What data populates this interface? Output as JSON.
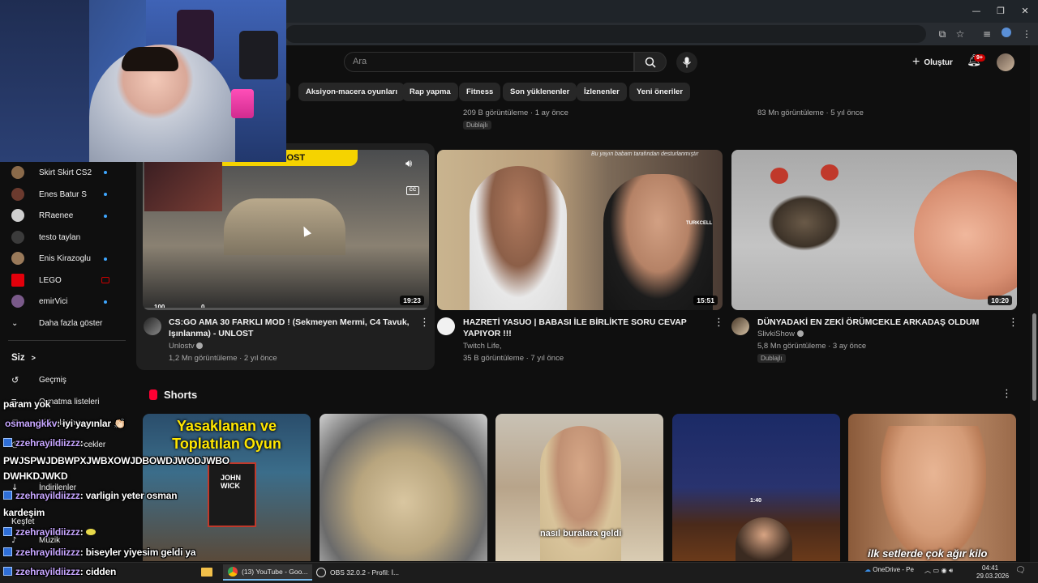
{
  "header": {
    "search_placeholder": "Ara",
    "create_label": "Oluştur",
    "notification_badge": "9+"
  },
  "chips": [
    "Aksiyon-macera oyunları",
    "Rap yapma",
    "Fitness",
    "Son yüklenenler",
    "İzlenenler",
    "Yeni öneriler"
  ],
  "prev_row": {
    "left_meta": "209 B görüntüleme · 1 ay önce",
    "left_badge": "Dublajlı",
    "right_meta": "83 Mn görüntüleme · 5 yıl önce"
  },
  "sidebar": {
    "subscriptions": [
      {
        "label": "Skirt Skirt CS2",
        "color": "#8a6a4a"
      },
      {
        "label": "Enes Batur S",
        "color": "#6b3a2e"
      },
      {
        "label": "RRaenee",
        "color": "#cfcfcf"
      },
      {
        "label": "testo taylan",
        "color": "#3b3b3b"
      },
      {
        "label": "Enis Kirazoglu",
        "color": "#9a7a5a"
      },
      {
        "label": "LEGO",
        "color": "#e3000b"
      },
      {
        "label": "emirVici",
        "color": "#7a5a8a"
      }
    ],
    "show_more": "Daha fazla göster",
    "you_label": "Siz",
    "you_chevron": ">",
    "history": "Geçmiş",
    "playlists": "Oynatma listeleri",
    "your_videos": "Videolarınız",
    "watch_later": "Sonra izlenecekler",
    "downloads": "İndirilenler",
    "explore": "Keşfet",
    "music": "Müzik"
  },
  "videos": [
    {
      "title": "CS:GO AMA 30 FARKLI MOD ! (Sekmeyen Mermi, C4 Tavuk, Işınlanma) - UNLOST",
      "channel": "Unlostv",
      "meta": "1,2 Mn görüntüleme · 2 yıl önce",
      "duration": "19:23",
      "banner": "UNLOST",
      "hud_left": "100",
      "hud_right": "0"
    },
    {
      "title": "HAZRETİ YASUO | BABASI İLE BİRLİKTE SORU CEVAP YAPIYOR !!!",
      "channel": "Twitch Life,",
      "meta": "35 B görüntüleme · 7 yıl önce",
      "duration": "15:51",
      "overlay": "Bu yayın babam tarafından desturlanmıştır",
      "logo": "TURKCELL"
    },
    {
      "title": "DÜNYADAKİ EN ZEKİ ÖRÜMCEKLE ARKADAŞ OLDUM",
      "channel": "SlivkiShow",
      "meta": "5,8 Mn görüntüleme · 3 ay önce",
      "duration": "10:20",
      "badge": "Dublajlı"
    }
  ],
  "shorts": {
    "title": "Shorts",
    "items": [
      {
        "caption": "Yasaklanan ve Toplatılan Oyun",
        "sub": "JOHN WICK"
      },
      {
        "caption": ""
      },
      {
        "caption": "nasıl buralara geldi"
      },
      {
        "caption": "",
        "hud": "1:40"
      },
      {
        "caption": "ilk setlerde çok ağır kilo"
      }
    ]
  },
  "chat": [
    {
      "user": "",
      "text": "param yok"
    },
    {
      "user": "osmangkkv",
      "text": ": iyi yayınlar 👏🏻"
    },
    {
      "user": "zzehrayildiizzz",
      "text": ":"
    },
    {
      "user": "",
      "text": "PWJSPWJDBWPXJWBXOWJDBOWDJWODJWBO"
    },
    {
      "user": "",
      "text": "DWHKDJWKD"
    },
    {
      "user": "zzehrayildiizzz",
      "text": ": varligin yeter osman"
    },
    {
      "user": "",
      "text": "kardeşim"
    },
    {
      "user": "zzehrayildiizzz",
      "text": ":"
    },
    {
      "user": "zzehrayildiizzz",
      "text": ": biseyler yiyesim geldi ya"
    },
    {
      "user": "zzehrayildiizzz",
      "text": ": cidden"
    }
  ],
  "taskbar": {
    "items": [
      "(13) YouTube - Goo...",
      "OBS 32.0.2 - Profil: İ..."
    ],
    "onedrive": "OneDrive - Pe",
    "time": "04:41",
    "date": "29.03.2026"
  }
}
